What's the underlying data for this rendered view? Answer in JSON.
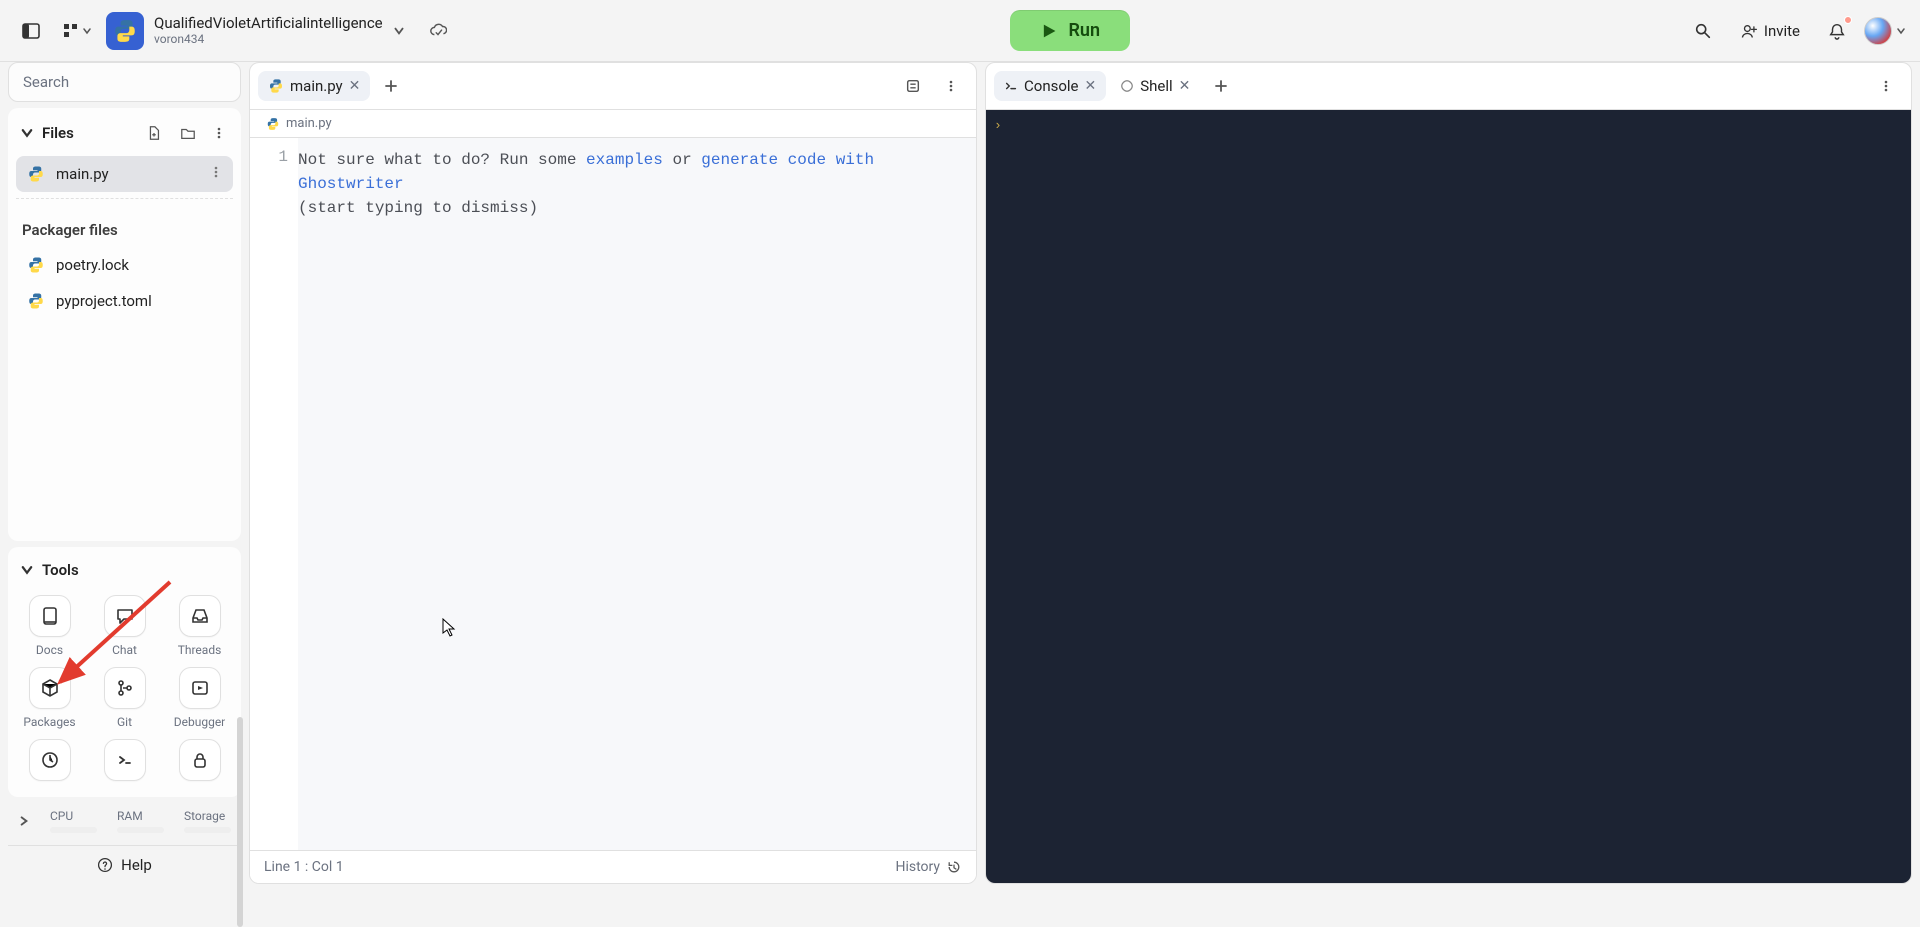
{
  "header": {
    "project_name": "QualifiedVioletArtificialintelligence",
    "user": "voron434",
    "run_label": "Run",
    "invite_label": "Invite"
  },
  "sidebar": {
    "search_placeholder": "Search",
    "files_label": "Files",
    "files": [
      {
        "name": "main.py",
        "active": true
      }
    ],
    "packager_label": "Packager files",
    "packager_files": [
      {
        "name": "poetry.lock"
      },
      {
        "name": "pyproject.toml"
      }
    ],
    "tools_label": "Tools",
    "tools": [
      {
        "label": "Docs",
        "icon": "docs"
      },
      {
        "label": "Chat",
        "icon": "chat"
      },
      {
        "label": "Threads",
        "icon": "threads"
      },
      {
        "label": "Packages",
        "icon": "packages"
      },
      {
        "label": "Git",
        "icon": "git"
      },
      {
        "label": "Debugger",
        "icon": "debugger"
      }
    ],
    "resources": {
      "cpu": "CPU",
      "ram": "RAM",
      "storage": "Storage"
    },
    "help_label": "Help"
  },
  "editor": {
    "tab_label": "main.py",
    "breadcrumb": "main.py",
    "line_number": "1",
    "placeholder_prefix": "Not sure what to do? Run some ",
    "placeholder_link1": "examples",
    "placeholder_mid": " or ",
    "placeholder_link2": "generate code with Ghostwriter",
    "placeholder_suffix": " (start typing to dismiss)",
    "status_left": "Line 1 : Col 1",
    "history_label": "History"
  },
  "right_pane": {
    "console_tab": "Console",
    "shell_tab": "Shell",
    "prompt_glyph": "›"
  }
}
